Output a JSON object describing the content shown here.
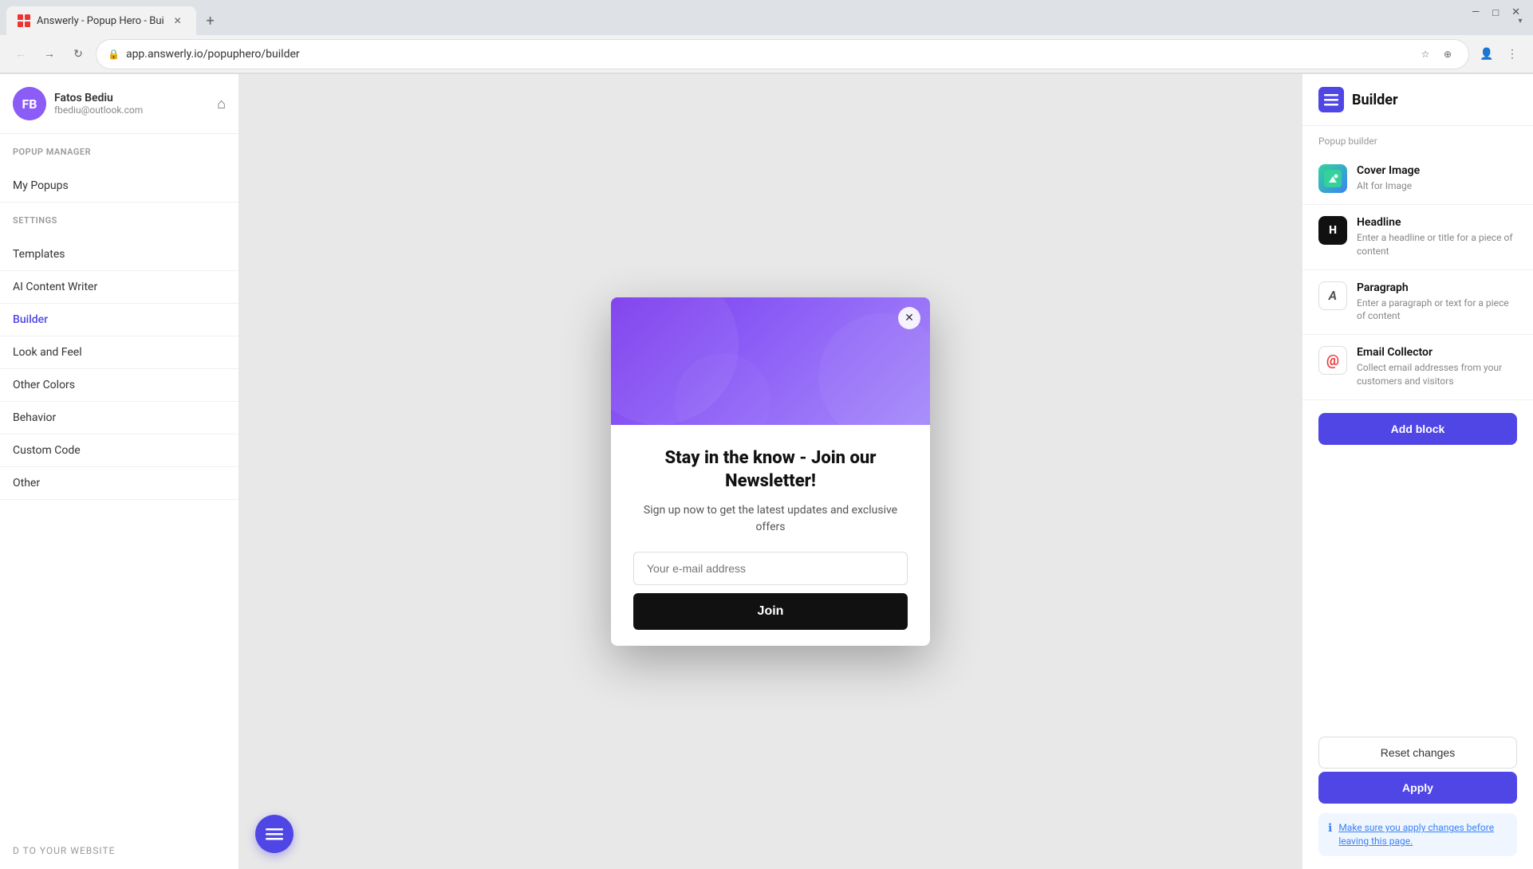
{
  "browser": {
    "tab_title": "Answerly - Popup Hero - Bui",
    "url": "app.answerly.io/popuphero/builder",
    "favicon": "🔴"
  },
  "window_controls": {
    "minimize": "—",
    "maximize": "□",
    "close": "✕"
  },
  "sidebar": {
    "user": {
      "name": "Fatos Bediu",
      "email": "fbediu@outlook.com"
    },
    "sections": [
      {
        "title": "POPUP MANAGER",
        "items": [
          {
            "label": "My Popups",
            "id": "my-popups"
          }
        ]
      },
      {
        "title": "SETTINGS",
        "items": [
          {
            "label": "Templates",
            "id": "templates"
          },
          {
            "label": "AI Content Writer",
            "id": "ai-content-writer"
          },
          {
            "label": "Builder",
            "id": "builder",
            "active": true
          },
          {
            "label": "Look and Feel",
            "id": "look-and-feel"
          },
          {
            "label": "Other Colors",
            "id": "other-colors"
          },
          {
            "label": "Behavior",
            "id": "behavior"
          },
          {
            "label": "Custom Code",
            "id": "custom-code"
          },
          {
            "label": "Other",
            "id": "other"
          }
        ]
      }
    ],
    "footer": {
      "add_to_website": "D TO YOUR WEBSITE"
    }
  },
  "popup": {
    "title": "Stay in the know - Join our Newsletter!",
    "subtitle": "Sign up now to get the latest updates and exclusive offers",
    "email_placeholder": "Your e-mail address",
    "join_button": "Join",
    "close_button": "✕"
  },
  "right_panel": {
    "header": {
      "title": "Builder",
      "icon": "≡"
    },
    "subtitle": "Popup builder",
    "items": [
      {
        "id": "cover-image",
        "title": "Cover Image",
        "description": "Alt for Image",
        "icon_type": "cover"
      },
      {
        "id": "headline",
        "title": "Headline",
        "description": "Enter a headline or title for a piece of content",
        "icon_type": "headline",
        "icon_text": "H"
      },
      {
        "id": "paragraph",
        "title": "Paragraph",
        "description": "Enter a paragraph or text for a piece of content",
        "icon_type": "paragraph",
        "icon_text": "A"
      },
      {
        "id": "email-collector",
        "title": "Email Collector",
        "description": "Collect email addresses from your customers and visitors",
        "icon_type": "email",
        "icon_text": "@"
      }
    ],
    "add_block_label": "Add block",
    "reset_label": "Reset changes",
    "apply_label": "Apply",
    "notice_text": "Make sure you apply changes before leaving this page."
  }
}
